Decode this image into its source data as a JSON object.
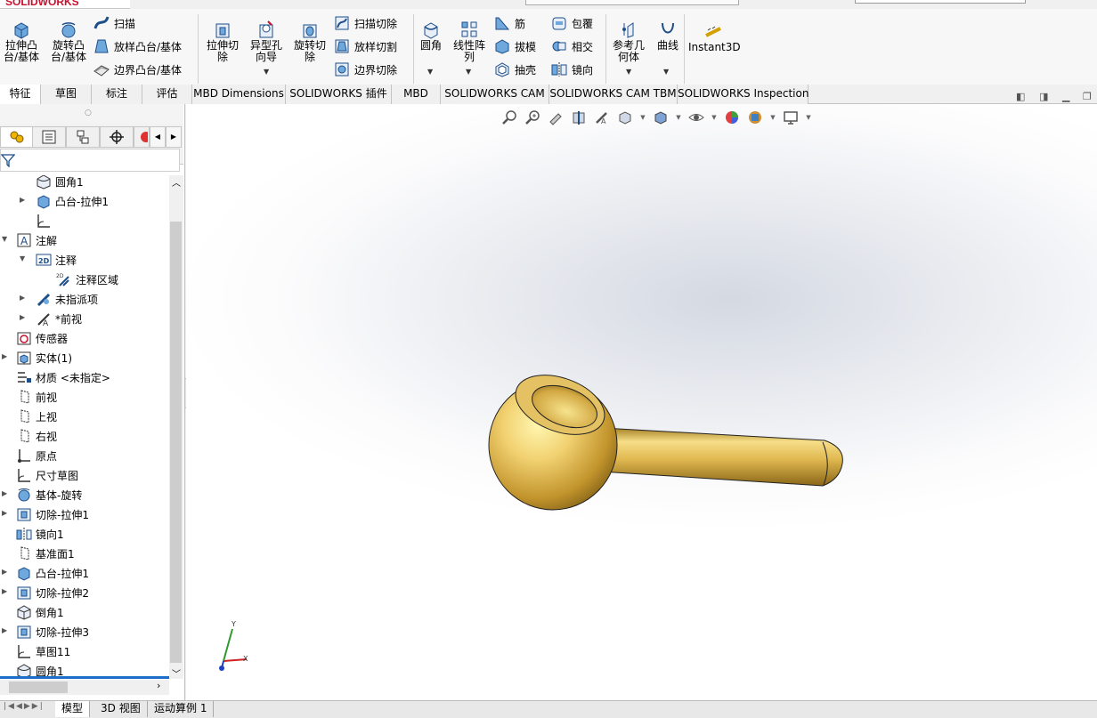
{
  "app": {
    "brand": "SOLIDWORKS"
  },
  "ribbon": {
    "extrude_boss": "拉伸凸\n台/基体",
    "revolve_boss": "旋转凸\n台/基体",
    "sweep": "扫描",
    "loft_boss": "放样凸台/基体",
    "boundary_boss": "边界凸台/基体",
    "extrude_cut": "拉伸切\n除",
    "hole_wizard": "异型孔\n向导",
    "revolve_cut": "旋转切\n除",
    "sweep_cut": "扫描切除",
    "loft_cut": "放样切割",
    "boundary_cut": "边界切除",
    "fillet": "圆角",
    "linear_pattern": "线性阵\n列",
    "rib": "筋",
    "draft": "拔模",
    "shell": "抽壳",
    "wrap": "包覆",
    "intersect": "相交",
    "mirror": "镜向",
    "ref_geometry": "参考几\n何体",
    "curves": "曲线",
    "instant3d": "Instant3D"
  },
  "tabs": [
    "特征",
    "草图",
    "标注",
    "评估",
    "MBD Dimensions",
    "SOLIDWORKS 插件",
    "MBD",
    "SOLIDWORKS CAM",
    "SOLIDWORKS CAM TBM",
    "SOLIDWORKS Inspection"
  ],
  "tree": [
    "圆角1",
    "凸台-拉伸1",
    "",
    "注解",
    "注释",
    "注释区域",
    "未指派项",
    "*前视",
    "传感器",
    "实体(1)",
    "材质 <未指定>",
    "前视",
    "上视",
    "右视",
    "原点",
    "尺寸草图",
    "基体-旋转",
    "切除-拉伸1",
    "镜向1",
    "基准面1",
    "凸台-拉伸1",
    "切除-拉伸2",
    "倒角1",
    "切除-拉伸3",
    "草图11",
    "圆角1"
  ],
  "triad": {
    "x": "X",
    "y": "Y"
  },
  "bottom_tabs": [
    "模型",
    "3D 视图",
    "运动算例 1"
  ],
  "colors": {
    "part": "#d4a63a",
    "accent": "#1b6fc8",
    "brand": "#c8102e"
  }
}
